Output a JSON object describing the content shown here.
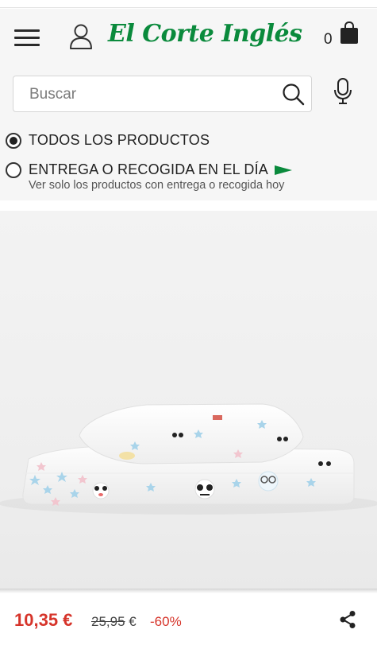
{
  "header": {
    "menu_icon": "hamburger-menu-icon",
    "user_icon": "user-icon",
    "logo_text": "El Corte Inglés",
    "cart_count": "0",
    "cart_icon": "shopping-bag-icon"
  },
  "search": {
    "placeholder": "Buscar",
    "value": "",
    "search_icon": "magnifier-icon",
    "voice_icon": "microphone-icon"
  },
  "filters": {
    "options": [
      {
        "label": "TODOS LOS PRODUCTOS",
        "selected": true
      },
      {
        "label": "ENTREGA O RECOGIDA EN EL DÍA",
        "selected": false
      }
    ],
    "same_day_note": "Ver solo los productos con entrega o recogida hoy"
  },
  "product": {
    "image_icon": "bedding-set-photo",
    "price_current": "10,35 €",
    "price_old_amount": "25,95",
    "price_old_currency": " €",
    "discount": "-60%",
    "share_icon": "share-icon"
  },
  "colors": {
    "brand_green": "#0a8a3c",
    "price_red": "#d6342a",
    "header_bg": "#f6f6f6"
  }
}
